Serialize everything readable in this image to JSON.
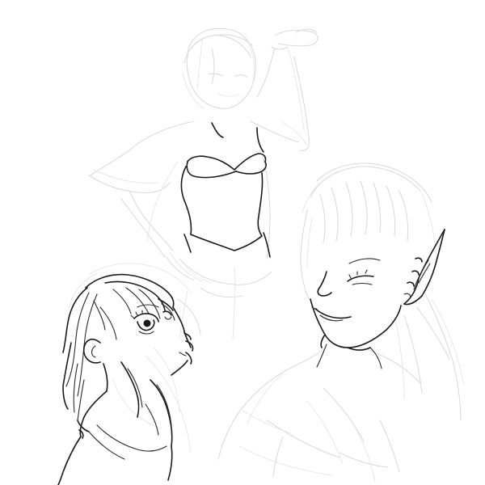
{
  "canvas": {
    "background": "#ffffff",
    "sketch_color": "#d9dcde",
    "ink_color": "#1a1a1a"
  },
  "figures": [
    {
      "name": "standing-figure-with-bodice"
    },
    {
      "name": "girl-looking-up"
    },
    {
      "name": "elf-girl-smiling"
    }
  ]
}
